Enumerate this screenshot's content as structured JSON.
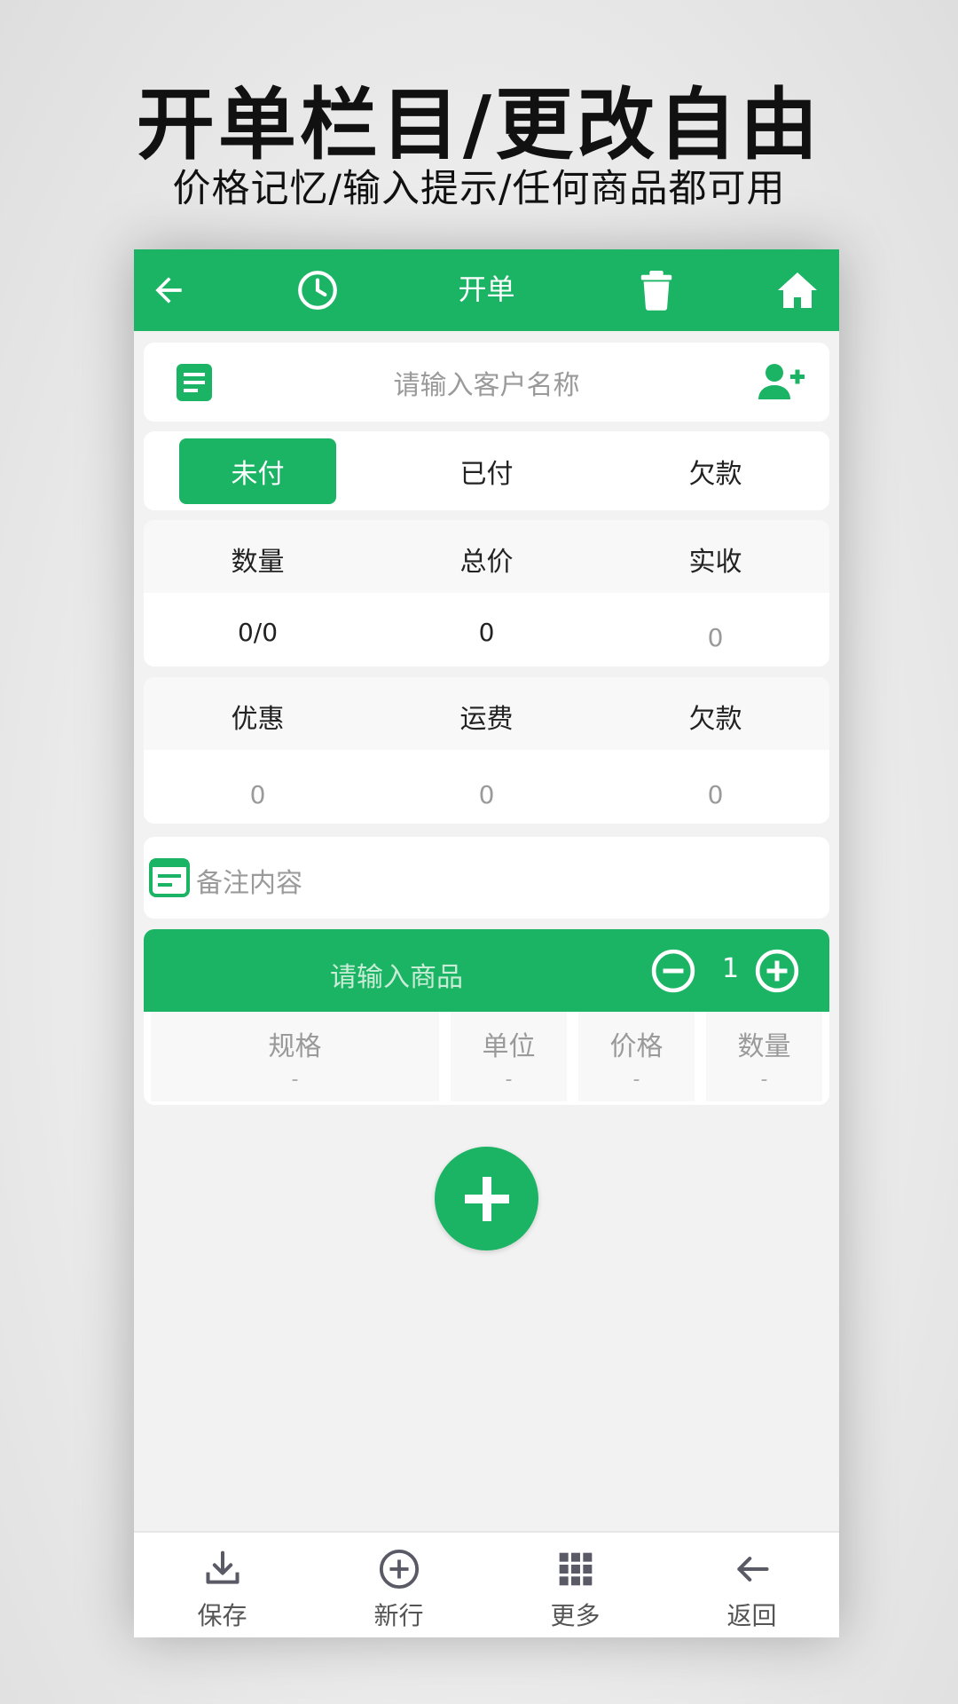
{
  "promo": {
    "title": "开单栏目/更改自由",
    "subtitle": "价格记忆/输入提示/任何商品都可用"
  },
  "topbar": {
    "title": "开单",
    "icons": [
      "back-arrow-icon",
      "history-clock-icon",
      "trash-icon",
      "home-icon"
    ],
    "color": "#1bb464"
  },
  "customer": {
    "placeholder": "请输入客户名称",
    "icons": [
      "document-icon",
      "add-user-icon"
    ]
  },
  "payment_tabs": {
    "items": [
      "未付",
      "已付",
      "欠款"
    ],
    "selected": "未付"
  },
  "summary": {
    "labels": [
      "数量",
      "总价",
      "实收"
    ],
    "values": [
      "0/0",
      "0",
      "0"
    ]
  },
  "extras": {
    "labels": [
      "优惠",
      "运费",
      "欠款"
    ],
    "values": [
      "0",
      "0",
      "0"
    ]
  },
  "note": {
    "placeholder": "备注内容"
  },
  "goods": {
    "placeholder": "请输入商品",
    "quantity": "1",
    "columns": [
      "规格",
      "单位",
      "价格",
      "数量"
    ],
    "values": [
      "-",
      "-",
      "-",
      "-"
    ]
  },
  "bottom_nav": {
    "items": [
      {
        "label": "保存",
        "icon": "download-icon"
      },
      {
        "label": "新行",
        "icon": "add-circle-icon"
      },
      {
        "label": "更多",
        "icon": "grid-icon"
      },
      {
        "label": "返回",
        "icon": "back-arrow-icon"
      }
    ]
  }
}
